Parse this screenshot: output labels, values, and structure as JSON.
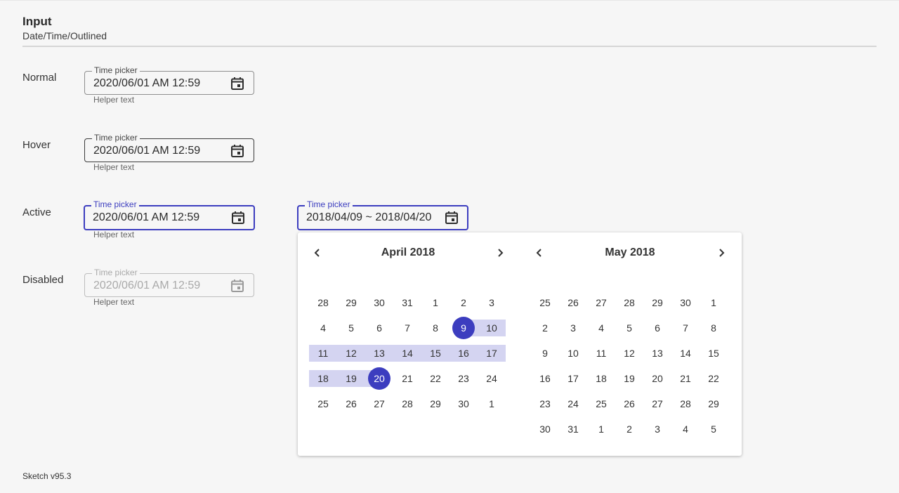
{
  "header": {
    "title": "Input",
    "subtitle": "Date/Time/Outlined"
  },
  "states": {
    "normal": {
      "label": "Normal",
      "field_label": "Time picker",
      "value": "2020/06/01 AM 12:59",
      "helper": "Helper text"
    },
    "hover": {
      "label": "Hover",
      "field_label": "Time picker",
      "value": "2020/06/01 AM 12:59",
      "helper": "Helper text"
    },
    "active": {
      "label": "Active",
      "field_label": "Time picker",
      "value": "2020/06/01 AM 12:59",
      "helper": "Helper text"
    },
    "disabled": {
      "label": "Disabled",
      "field_label": "Time picker",
      "value": "2020/06/01 AM 12:59",
      "helper": "Helper text"
    }
  },
  "range_field": {
    "field_label": "Time picker",
    "value": "2018/04/09 ~ 2018/04/20"
  },
  "calendar": {
    "left": {
      "title": "April 2018",
      "weeks": [
        [
          "28",
          "29",
          "30",
          "31",
          "1",
          "2",
          "3"
        ],
        [
          "4",
          "5",
          "6",
          "7",
          "8",
          "9",
          "10"
        ],
        [
          "11",
          "12",
          "13",
          "14",
          "15",
          "16",
          "17"
        ],
        [
          "18",
          "19",
          "20",
          "21",
          "22",
          "23",
          "24"
        ],
        [
          "25",
          "26",
          "27",
          "28",
          "29",
          "30",
          "1"
        ]
      ],
      "range_start": "9",
      "range_end": "20"
    },
    "right": {
      "title": "May 2018",
      "weeks": [
        [
          "25",
          "26",
          "27",
          "28",
          "29",
          "30",
          "1"
        ],
        [
          "2",
          "3",
          "4",
          "5",
          "6",
          "7",
          "8"
        ],
        [
          "9",
          "10",
          "11",
          "12",
          "13",
          "14",
          "15"
        ],
        [
          "16",
          "17",
          "18",
          "19",
          "20",
          "21",
          "22"
        ],
        [
          "23",
          "24",
          "25",
          "26",
          "27",
          "28",
          "29"
        ],
        [
          "30",
          "31",
          "1",
          "2",
          "3",
          "4",
          "5"
        ]
      ]
    }
  },
  "colors": {
    "accent": "#3c3dbf",
    "range_fill": "#d4d4f1",
    "background": "#f6f6f6"
  },
  "icons": {
    "field_icon": "calendar-icon",
    "prev": "chevron-left-icon",
    "next": "chevron-right-icon"
  },
  "footer": {
    "version": "Sketch v95.3"
  }
}
